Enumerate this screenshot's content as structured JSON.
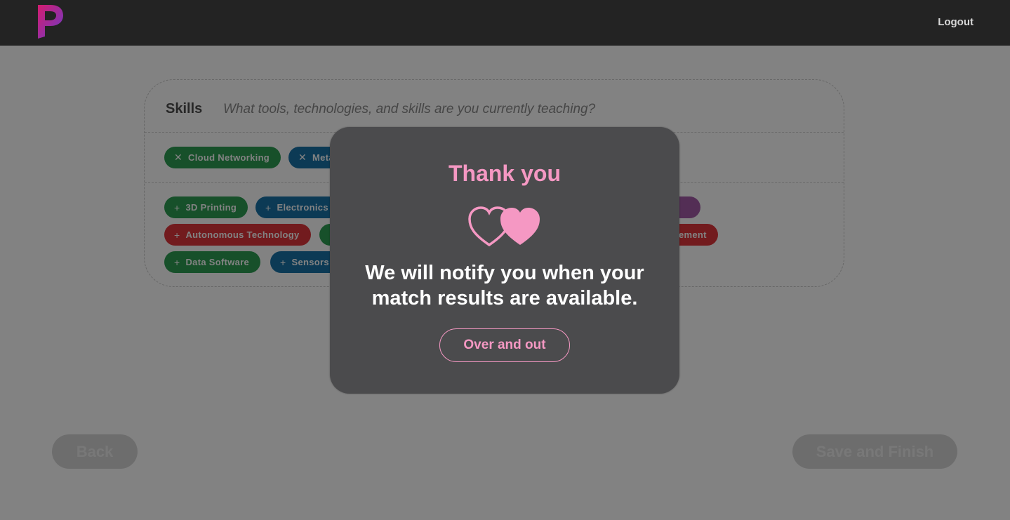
{
  "header": {
    "logo_text": "P",
    "logout_label": "Logout"
  },
  "skills": {
    "label": "Skills",
    "placeholder": "What tools, technologies, and skills are you currently teaching?",
    "selected": [
      {
        "label": "Cloud Networking",
        "color": "#2e9e54"
      },
      {
        "label": "Metal Fabrication",
        "color": "#1873a8"
      },
      {
        "label": "",
        "color": "#e08a3a"
      }
    ],
    "suggested": [
      {
        "label": "3D Printing",
        "color": "#2e9e54"
      },
      {
        "label": "Electronics",
        "color": "#1873a8"
      },
      {
        "label": "",
        "color": "#e08a3a"
      },
      {
        "label": "",
        "color": "#e08a3a"
      },
      {
        "label": "",
        "color": "#a35aa8"
      },
      {
        "label": "",
        "color": "#a35aa8"
      },
      {
        "label": "Autonomous Technology",
        "color": "#e0353c"
      },
      {
        "label": "",
        "color": "#2e9e54"
      },
      {
        "label": "",
        "color": "#e08a3a"
      },
      {
        "label": "",
        "color": "#e08a3a"
      },
      {
        "label": "Energy Management",
        "color": "#e0353c"
      },
      {
        "label": "Data Software",
        "color": "#2e9e54"
      },
      {
        "label": "Sensors",
        "color": "#1873a8"
      },
      {
        "label": "",
        "color": "#e08a3a"
      },
      {
        "label": "",
        "color": "#e08a3a"
      }
    ]
  },
  "footer": {
    "back_label": "Back",
    "save_label": "Save and Finish"
  },
  "modal": {
    "title": "Thank you",
    "icon": "linked-hearts-icon",
    "message_line1": "We will notify you when your",
    "message_line2": "match results are available.",
    "button_label": "Over and out"
  },
  "colors": {
    "accent_pink": "#f598c3",
    "topbar": "#232323",
    "modal_bg": "#4b4b4d"
  }
}
